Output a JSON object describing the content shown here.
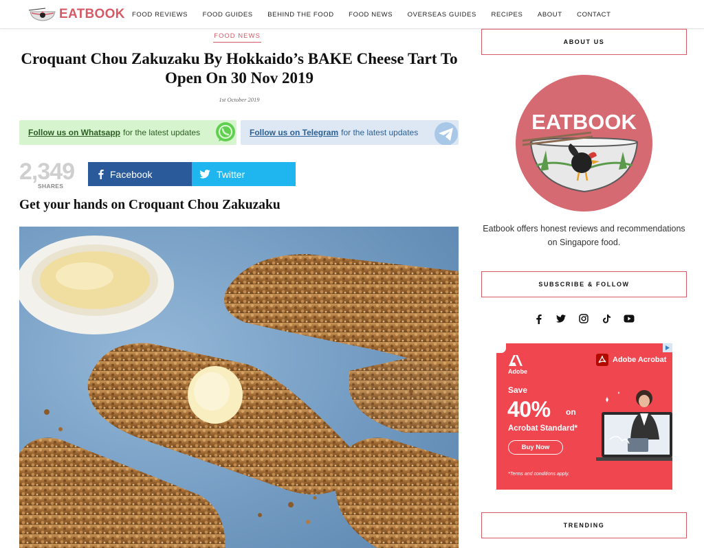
{
  "header": {
    "logo_text": "EATBOOK",
    "nav": [
      "FOOD REVIEWS",
      "FOOD GUIDES",
      "BEHIND THE FOOD",
      "FOOD NEWS",
      "OVERSEAS GUIDES",
      "RECIPES",
      "ABOUT",
      "CONTACT"
    ]
  },
  "article": {
    "category": "FOOD NEWS",
    "title": "Croquant Chou Zakuzaku By Hokkaido’s BAKE Cheese Tart To Open On 30 Nov 2019",
    "date": "1st October 2019",
    "whatsapp": {
      "link": "Follow us on Whatsapp",
      "text": "for the latest updates"
    },
    "telegram": {
      "link": "Follow us on Telegram",
      "text": "for the latest updates"
    },
    "share_count": "2,349",
    "share_label": "SHARES",
    "facebook_label": "Facebook",
    "twitter_label": "Twitter",
    "subheading": "Get your hands on Croquant Chou Zakuzaku"
  },
  "sidebar": {
    "about_heading": "ABOUT US",
    "about_logo_text": "EATBOOK",
    "about_text": "Eatbook offers honest reviews and recommendations on Singapore food.",
    "subscribe_heading": "SUBSCRIBE & FOLLOW",
    "social_icons": [
      "facebook-icon",
      "twitter-icon",
      "instagram-icon",
      "tiktok-icon",
      "youtube-icon"
    ],
    "trending_heading": "TRENDING"
  },
  "ad": {
    "adobe_mark": "Adobe",
    "brand": "Adobe Acrobat",
    "save": "Save",
    "percent": "40%",
    "on": "on",
    "product": "Acrobat Standard*",
    "button": "Buy Now",
    "terms": "*Terms and conditions apply."
  },
  "colors": {
    "brand": "#d55a66",
    "whatsapp_bg": "#d6f5cf",
    "telegram_bg": "#dde8f4",
    "facebook": "#2b5a9b",
    "twitter": "#1fb6f0",
    "ad_bg": "#f0464f"
  }
}
